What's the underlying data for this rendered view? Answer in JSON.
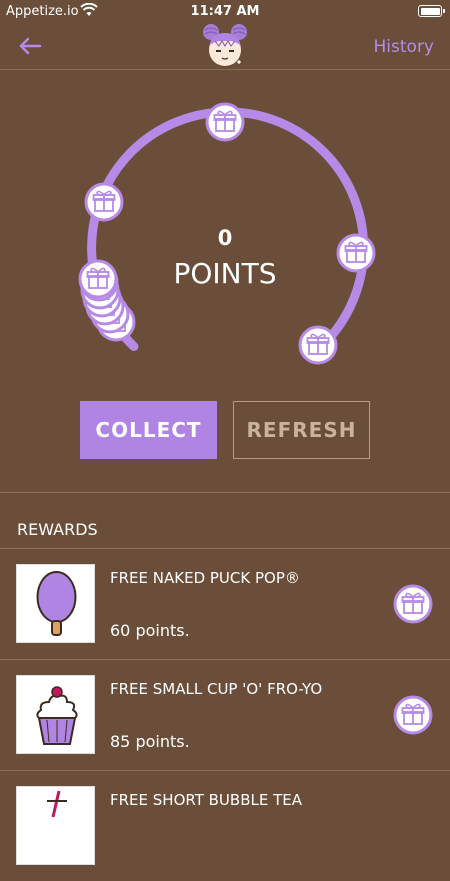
{
  "status_bar": {
    "carrier": "Appetize.io",
    "time": "11:47 AM"
  },
  "nav": {
    "history_label": "History"
  },
  "points": {
    "value": "0",
    "label": "POINTS"
  },
  "actions": {
    "collect_label": "COLLECT",
    "refresh_label": "REFRESH"
  },
  "rewards": {
    "title": "REWARDS",
    "items": [
      {
        "name": "FREE NAKED PUCK POP®",
        "points_text": "60 points."
      },
      {
        "name": "FREE SMALL CUP 'O' FRO-YO",
        "points_text": "85 points."
      },
      {
        "name": "FREE SHORT BUBBLE TEA",
        "points_text": ""
      }
    ]
  },
  "colors": {
    "background": "#6b4e39",
    "accent": "#b084e2",
    "ring": "#b68ae6"
  },
  "icons": [
    "back-arrow-icon",
    "gift-icon",
    "wifi-icon",
    "battery-icon"
  ]
}
